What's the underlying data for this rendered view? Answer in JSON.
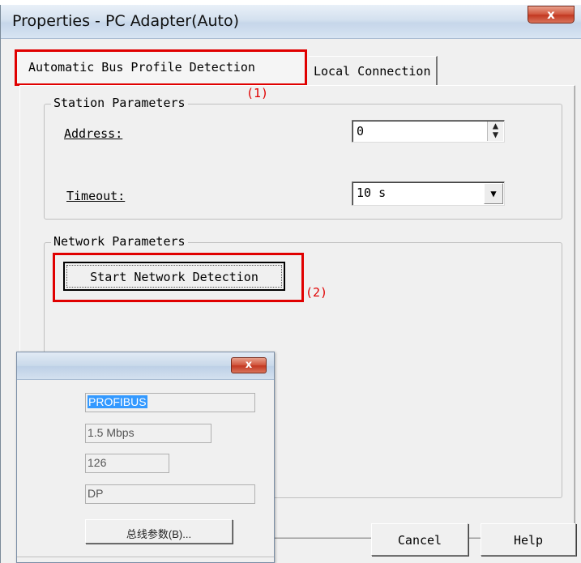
{
  "window": {
    "title": "Properties - PC Adapter(Auto)",
    "close_glyph": "x"
  },
  "tabs": [
    {
      "label": "Automatic Bus Profile Detection"
    },
    {
      "label": "Local Connection"
    }
  ],
  "annotations": {
    "tab": "(1)",
    "button": "(2)"
  },
  "station": {
    "legend": "Station Parameters",
    "address_label": "Address:",
    "address_value": "0",
    "timeout_label": "Timeout:",
    "timeout_value": "10 s"
  },
  "network": {
    "legend": "Network Parameters",
    "detect_button": "Start Network Detection"
  },
  "footer": {
    "cancel": "Cancel",
    "help": "Help"
  },
  "popup": {
    "close_glyph": "x",
    "fields": [
      "PROFIBUS",
      "1.5 Mbps",
      "126",
      "DP"
    ],
    "bus_params_button": "总线参数(B)..."
  },
  "colors": {
    "annotation": "#e00000",
    "selection": "#3399ff"
  }
}
